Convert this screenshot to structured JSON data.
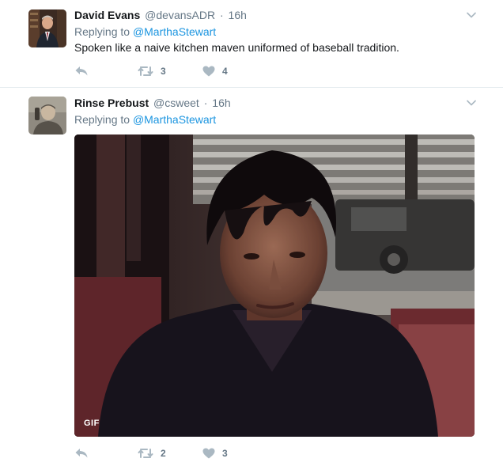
{
  "tweets": [
    {
      "author": {
        "name": "David Evans",
        "handle": "@devansADR",
        "avatar_icon": "profile-photo-man-in-suit"
      },
      "separator": "·",
      "time": "16h",
      "reply_prefix": "Replying to",
      "reply_to": "@MarthaStewart",
      "text": "Spoken like a naive kitchen maven uniformed of baseball tradition.",
      "actions": {
        "reply_icon": "reply-icon",
        "retweets": "3",
        "likes": "4"
      }
    },
    {
      "author": {
        "name": "Rinse Prebust",
        "handle": "@csweet",
        "avatar_icon": "profile-photo-man-on-phone"
      },
      "separator": "·",
      "time": "16h",
      "reply_prefix": "Replying to",
      "reply_to": "@MarthaStewart",
      "media": {
        "type": "gif",
        "badge": "GIF",
        "description_icon": "gif-man-in-diner-booth"
      },
      "actions": {
        "reply_icon": "reply-icon",
        "retweets": "2",
        "likes": "3"
      }
    }
  ],
  "colors": {
    "text": "#14171a",
    "muted": "#657786",
    "link": "#1b95e0",
    "action_icon": "#aab8c2",
    "divider": "#e6ecf0"
  }
}
